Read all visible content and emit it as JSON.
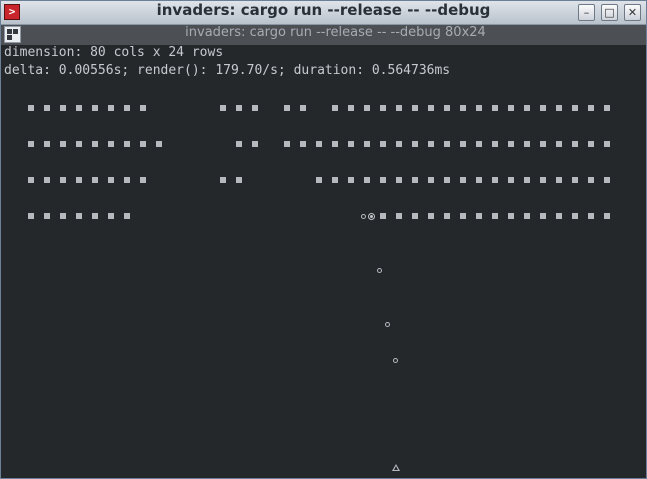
{
  "window": {
    "title": "invaders: cargo run --release -- --debug",
    "icon": "terminal-app-icon",
    "controls": {
      "minimize": "minimize-icon",
      "maximize": "maximize-icon",
      "close": "close-icon"
    }
  },
  "tab": {
    "label": "invaders: cargo run --release -- --debug 80x24",
    "icon": "tab-grid-icon"
  },
  "debug": {
    "dimension": "dimension: 80 cols x 24 rows",
    "stats": "delta: 0.00556s; render(): 179.70/s; duration: 0.564736ms"
  },
  "game": {
    "columns": 80,
    "rows": 24,
    "invader_rows": [
      [
        2,
        3,
        4,
        5,
        6,
        7,
        8,
        9,
        14,
        15,
        16,
        18,
        19,
        21,
        22,
        23,
        24,
        25,
        26,
        27,
        28,
        29,
        30,
        31,
        32,
        33,
        34,
        35,
        36,
        37,
        38
      ],
      [
        2,
        3,
        4,
        5,
        6,
        7,
        8,
        9,
        10,
        15,
        16,
        18,
        19,
        20,
        21,
        22,
        23,
        24,
        25,
        26,
        27,
        28,
        29,
        30,
        31,
        32,
        33,
        34,
        35,
        36,
        37,
        38
      ],
      [
        2,
        3,
        4,
        5,
        6,
        7,
        8,
        9,
        14,
        15,
        20,
        21,
        22,
        23,
        24,
        25,
        26,
        27,
        28,
        29,
        30,
        31,
        32,
        33,
        34,
        35,
        36,
        37,
        38
      ],
      [
        2,
        3,
        4,
        5,
        6,
        7,
        8,
        24,
        25,
        26,
        27,
        28,
        29,
        30,
        31,
        32,
        33,
        34,
        35,
        36,
        37,
        38
      ]
    ],
    "bullets": [
      {
        "col": 22.8,
        "row": 3
      },
      {
        "col": 23.8,
        "row": 8
      },
      {
        "col": 24.3,
        "row": 11
      },
      {
        "col": 24.8,
        "row": 13
      }
    ],
    "hit": {
      "col": 23.3,
      "row": 6
    },
    "ship": {
      "col": 24.8,
      "row": 23
    }
  },
  "colors": {
    "terminal_background": "#25282b",
    "terminal_text": "#c6cacf",
    "titlebar": "#cdd4dc",
    "tabbar": "#4c5055",
    "app_icon": "#c8262c"
  }
}
